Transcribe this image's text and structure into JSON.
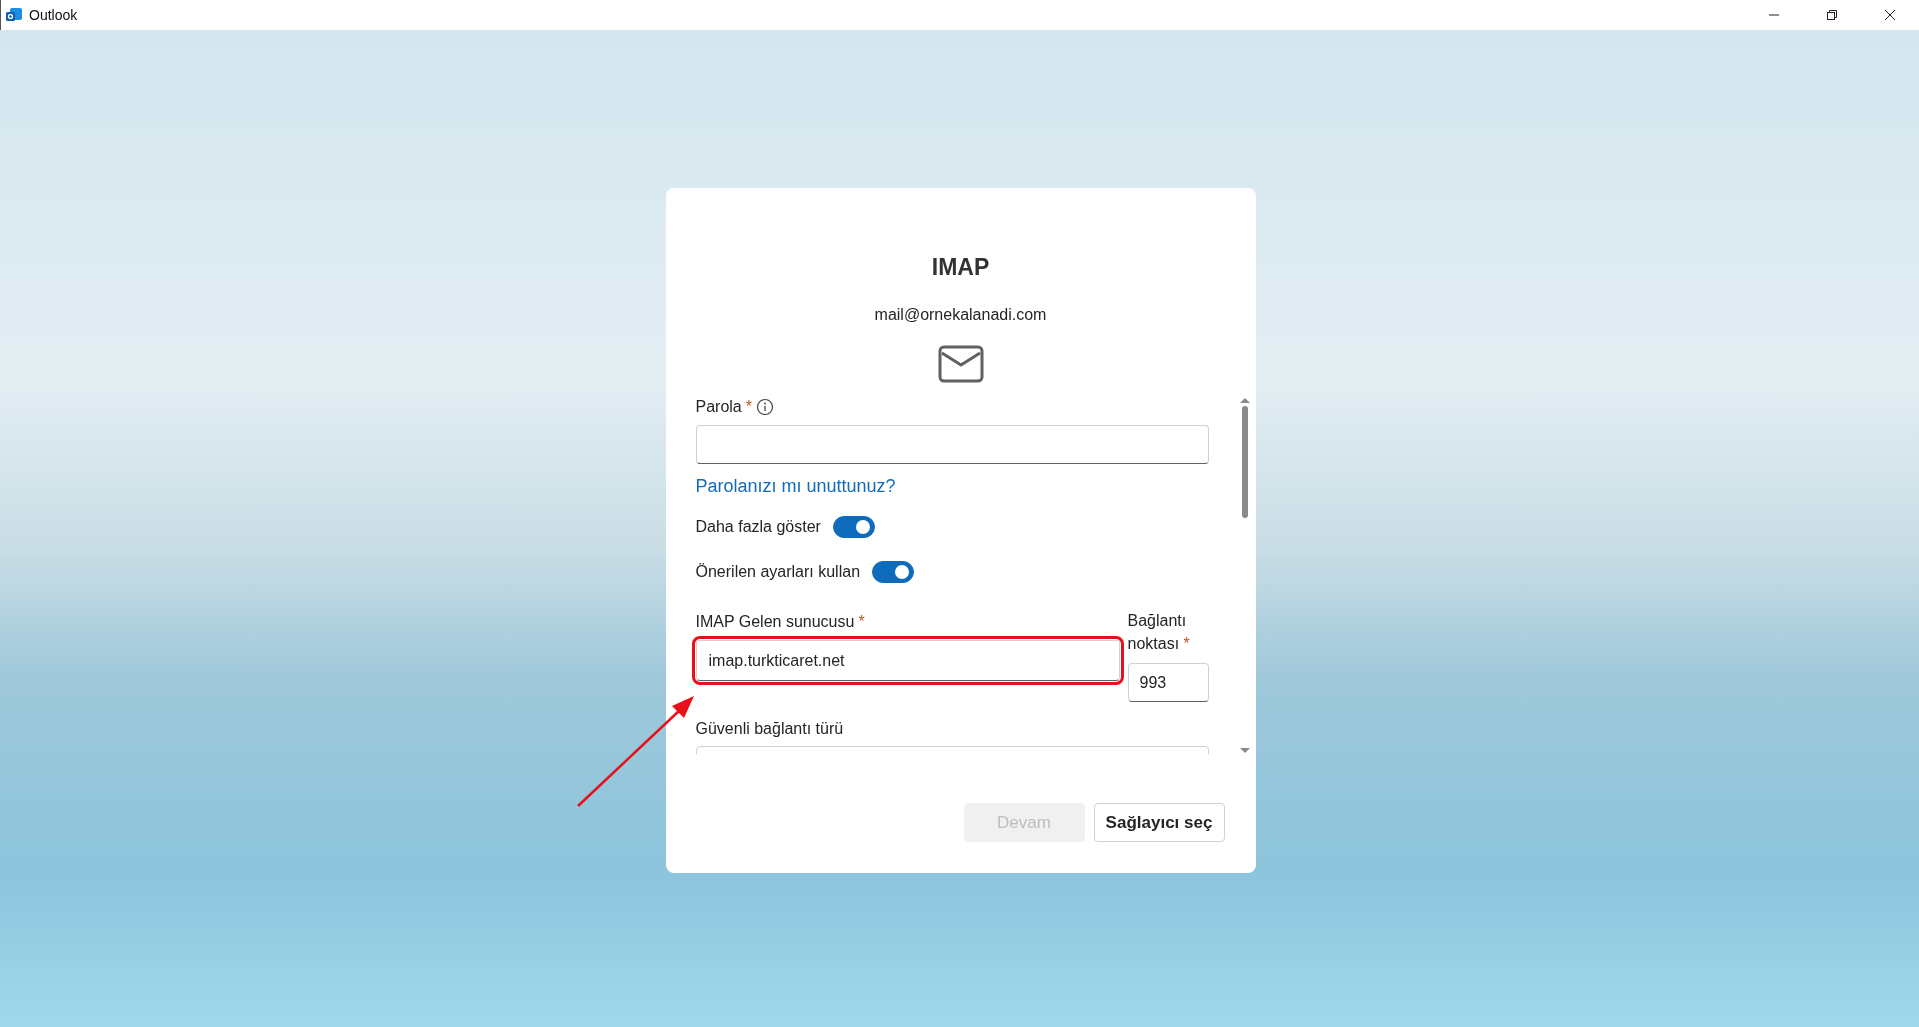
{
  "window": {
    "title": "Outlook"
  },
  "dialog": {
    "title": "IMAP",
    "account": "mail@ornekalanadi.com",
    "password": {
      "label": "Parola",
      "required_mark": "*"
    },
    "forgot_link": "Parolanızı mı unuttunuz?",
    "toggles": [
      {
        "label": "Daha fazla göster",
        "on": true
      },
      {
        "label": "Önerilen ayarları kullan",
        "on": true
      }
    ],
    "server": {
      "label": "IMAP Gelen sunucusu",
      "required_mark": "*",
      "value": "imap.turkticaret.net",
      "highlighted": true
    },
    "port": {
      "label": "Bağlantı noktası",
      "required_mark": "*",
      "value": "993"
    },
    "security": {
      "label": "Güvenli bağlantı türü"
    },
    "buttons": [
      {
        "label": "Devam",
        "disabled": true
      },
      {
        "label": "Sağlayıcı seç",
        "disabled": false
      }
    ]
  }
}
